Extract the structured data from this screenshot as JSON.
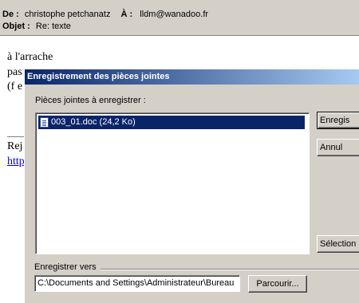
{
  "message": {
    "from_label": "De :",
    "from_value": "christophe petchanatz",
    "to_label": "À :",
    "to_value": "lldm@wanadoo.fr",
    "subject_label": "Objet :",
    "subject_value": "Re: texte",
    "body_lines": [
      "à l'arrache",
      "pas",
      "(f e",
      "Rej",
      "http"
    ]
  },
  "dialog": {
    "title": "Enregistrement des pièces jointes",
    "attachments_label": "Pièces jointes à enregistrer :",
    "attachments": [
      {
        "name": "003_01.doc (24,2 Ko)",
        "icon": "word-document-icon",
        "selected": true
      }
    ],
    "save_button": "Enregis",
    "cancel_button": "Annul",
    "select_all_button": "Sélection",
    "save_to_label": "Enregistrer vers",
    "save_path": "C:\\Documents and Settings\\Administrateur\\Bureau",
    "browse_button": "Parcourir...",
    "colors": {
      "selection": "#0a246a",
      "titlebar_start": "#0a246a",
      "titlebar_end": "#a6caf0",
      "face": "#d4d0c8"
    }
  }
}
